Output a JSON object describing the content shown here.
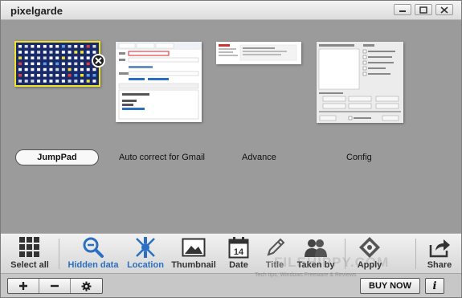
{
  "app": {
    "title": "pixelgarde"
  },
  "window_controls": {
    "minimize_icon": "minimize-icon",
    "maximize_icon": "maximize-icon",
    "close_icon": "close-icon"
  },
  "presets": [
    {
      "label": "JumpPad",
      "selected": true
    },
    {
      "label": "Auto correct for Gmail",
      "selected": false
    },
    {
      "label": "Advance",
      "selected": false
    },
    {
      "label": "Config",
      "selected": false
    }
  ],
  "toolbar": {
    "items": [
      {
        "label": "Select all",
        "icon": "grid-icon"
      },
      {
        "label": "Hidden data",
        "icon": "magnify-minus-icon"
      },
      {
        "label": "Location",
        "icon": "satellite-icon"
      },
      {
        "label": "Thumbnail",
        "icon": "picture-icon"
      },
      {
        "label": "Date",
        "icon": "calendar-icon"
      },
      {
        "label": "Title",
        "icon": "pencil-icon"
      },
      {
        "label": "Taken by",
        "icon": "people-icon"
      },
      {
        "label": "Apply",
        "icon": "apply-badge-icon"
      },
      {
        "label": "Share",
        "icon": "share-icon"
      }
    ],
    "calendar_day": "14"
  },
  "bottom": {
    "add_icon": "plus-icon",
    "remove_icon": "minus-icon",
    "settings_icon": "gear-icon",
    "buy_label": "BUY NOW",
    "info_label": "i"
  },
  "watermark": {
    "main": "FILEHIPPY.COM",
    "sub": "Tech tips, Windows Freeware & Reviews"
  },
  "colors": {
    "accent_blue": "#2a6fc1",
    "selected_border": "#f2e22a",
    "thumb_dark": "#182a6a"
  }
}
